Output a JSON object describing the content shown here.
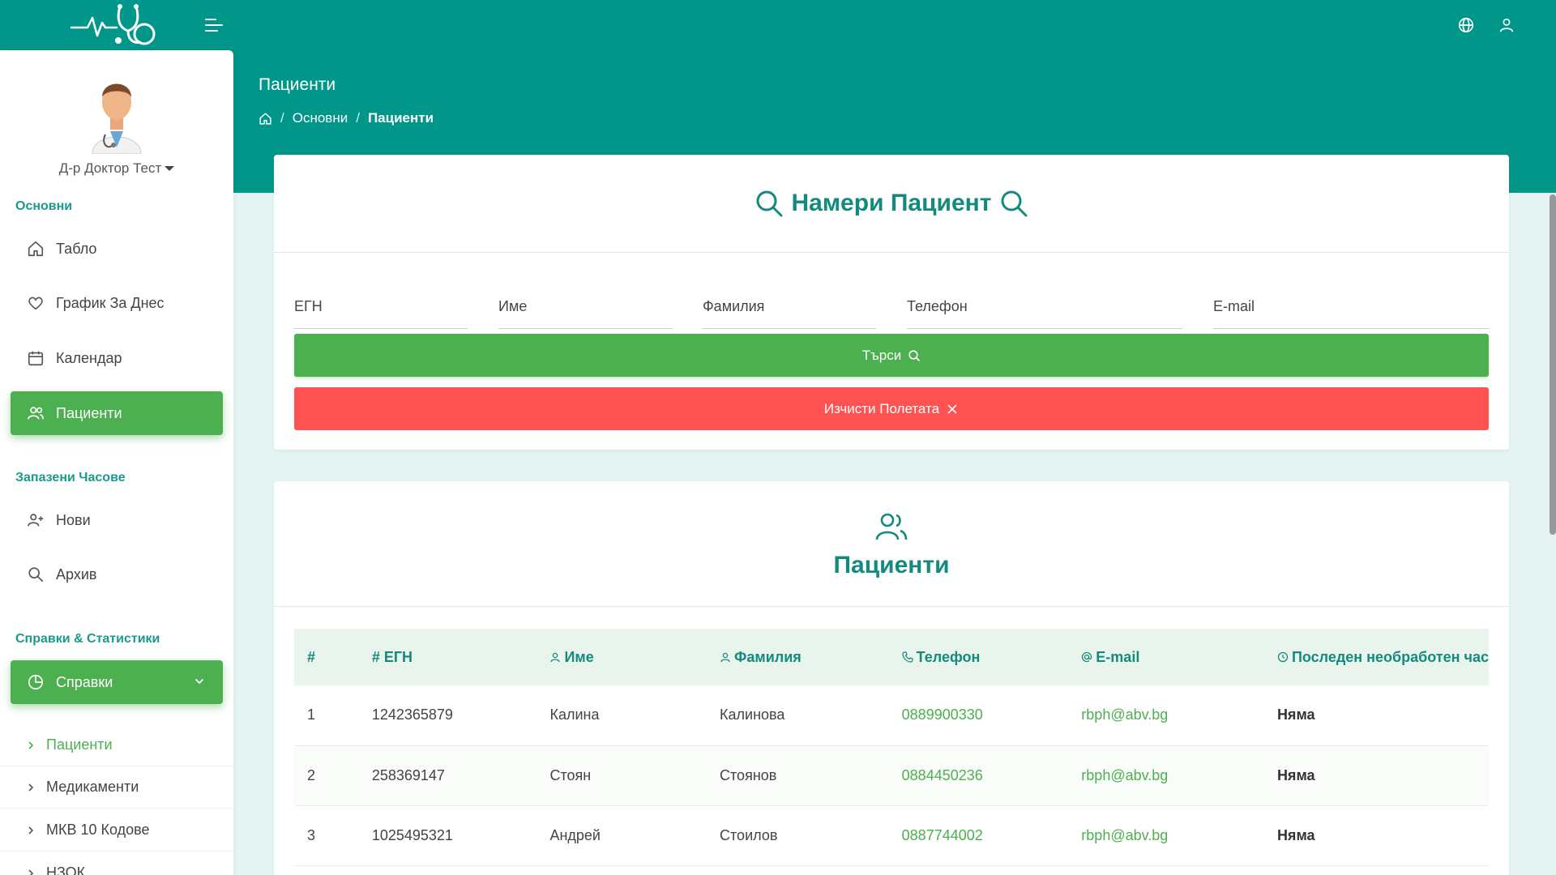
{
  "header": {
    "page_title": "Пациенти",
    "breadcrumb": [
      "Основни",
      "Пациенти"
    ]
  },
  "icons": {
    "logo": "stethoscope-heartbeat-logo",
    "menu": "menu-lines-icon",
    "language": "globe-icon",
    "user": "user-icon"
  },
  "colors": {
    "primary": "#00968a",
    "accent_green": "#4caf50",
    "danger": "#ff5252",
    "title_teal": "#138a7e"
  },
  "sidebar": {
    "user_name": "Д-р Доктор Тест",
    "sections": {
      "main": "Основни",
      "appointments": "Запазени Часове",
      "reports": "Справки & Статистики"
    },
    "items": {
      "dashboard": "Табло",
      "today": "График За Днес",
      "calendar": "Календар",
      "patients": "Пациенти",
      "new": "Нови",
      "archive": "Архив",
      "reports": "Справки"
    },
    "sub_items": [
      "Пациенти",
      "Медикаменти",
      "МКВ 10 Кодове",
      "НЗОК"
    ]
  },
  "search": {
    "title": "Намери Пациент",
    "fields": {
      "egn": "ЕГН",
      "first_name": "Име",
      "last_name": "Фамилия",
      "phone": "Телефон",
      "email": "E-mail"
    },
    "search_button": "Търси",
    "clear_button": "Изчисти Полетата"
  },
  "patients": {
    "title": "Пациенти",
    "columns": [
      "#",
      "# ЕГН",
      "Име",
      "Фамилия",
      "Телефон",
      "E-mail",
      "Последен необработен час"
    ],
    "rows": [
      {
        "n": "1",
        "egn": "1242365879",
        "first": "Калина",
        "last": "Калинова",
        "phone": "0889900330",
        "email": "rbph@abv.bg",
        "last_visit": "Няма"
      },
      {
        "n": "2",
        "egn": "258369147",
        "first": "Стоян",
        "last": "Стоянов",
        "phone": "0884450236",
        "email": "rbph@abv.bg",
        "last_visit": "Няма"
      },
      {
        "n": "3",
        "egn": "1025495321",
        "first": "Андрей",
        "last": "Стоилов",
        "phone": "0887744002",
        "email": "rbph@abv.bg",
        "last_visit": "Няма"
      }
    ]
  }
}
